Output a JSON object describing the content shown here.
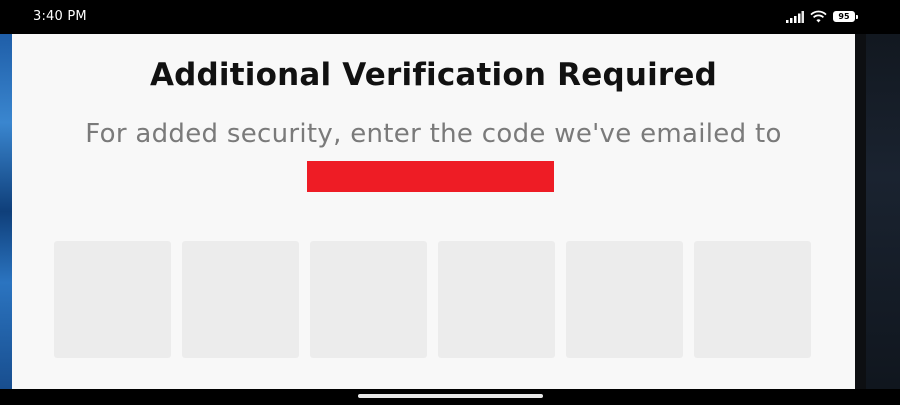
{
  "status_bar": {
    "time": "3:40 PM",
    "battery": "95",
    "icons": [
      "signal-icon",
      "wifi-icon",
      "battery-icon"
    ]
  },
  "dialog": {
    "title": "Additional Verification Required",
    "subtitle": "For added security, enter the code we've emailed to",
    "email_redacted": true,
    "code_length": 6,
    "code_values": [
      "",
      "",
      "",
      "",
      "",
      ""
    ]
  },
  "colors": {
    "dialog_background": "#f8f8f8",
    "code_box": "#ececec",
    "redaction": "#ee1c25",
    "title_text": "#111111",
    "subtitle_text": "#7a7a7a"
  }
}
